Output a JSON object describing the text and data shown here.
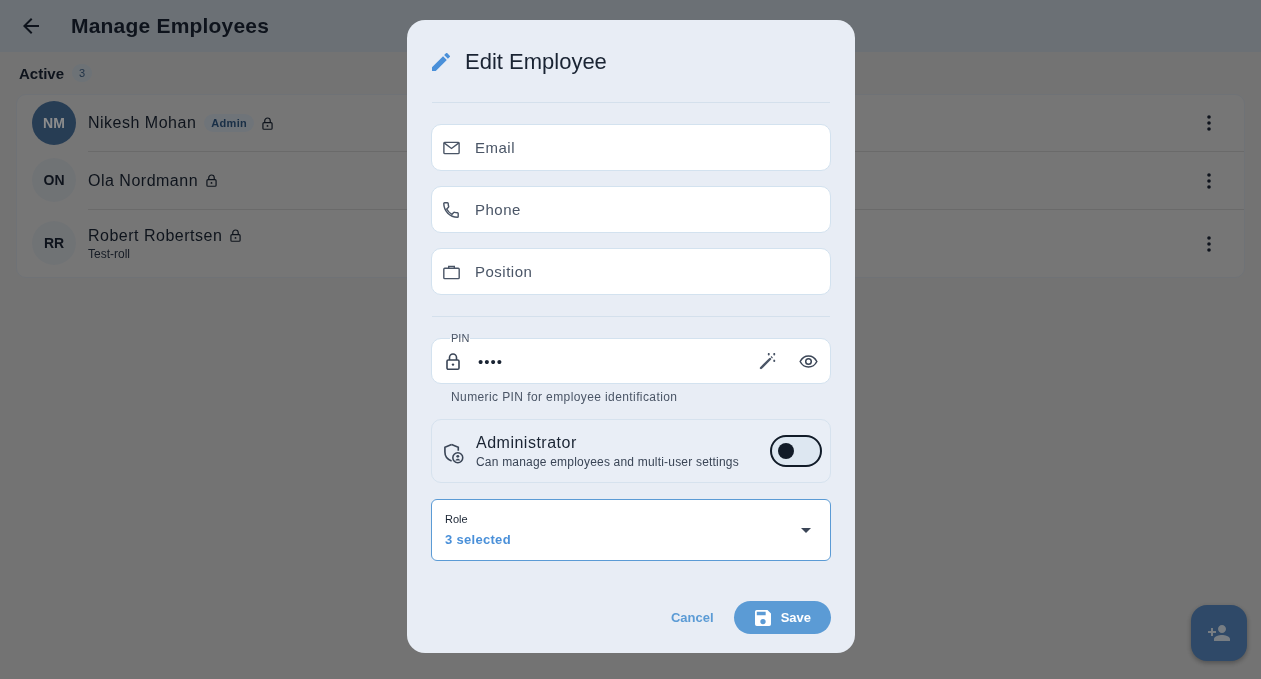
{
  "header": {
    "title": "Manage Employees"
  },
  "section": {
    "title": "Active",
    "count": "3"
  },
  "employees": [
    {
      "initials": "NM",
      "name": "Nikesh Mohan",
      "admin": true,
      "badge": "Admin",
      "locked": true
    },
    {
      "initials": "ON",
      "name": "Ola Nordmann",
      "admin": false,
      "locked": true
    },
    {
      "initials": "RR",
      "name": "Robert Robertsen",
      "admin": false,
      "locked": true,
      "role": "Test-roll"
    }
  ],
  "dialog": {
    "title": "Edit Employee",
    "fields": [
      {
        "kind": "email",
        "placeholder": "Email"
      },
      {
        "kind": "phone",
        "placeholder": "Phone"
      },
      {
        "kind": "position",
        "placeholder": "Position"
      }
    ],
    "pin": {
      "label": "PIN",
      "value": "••••",
      "hint": "Numeric PIN for employee identification"
    },
    "administrator": {
      "title": "Administrator",
      "description": "Can manage employees and multi-user settings",
      "on": false
    },
    "role": {
      "label": "Role",
      "value": "3 selected"
    },
    "buttons": [
      {
        "kind": "cancel",
        "label": "Cancel"
      },
      {
        "kind": "save",
        "label": "Save"
      }
    ]
  }
}
